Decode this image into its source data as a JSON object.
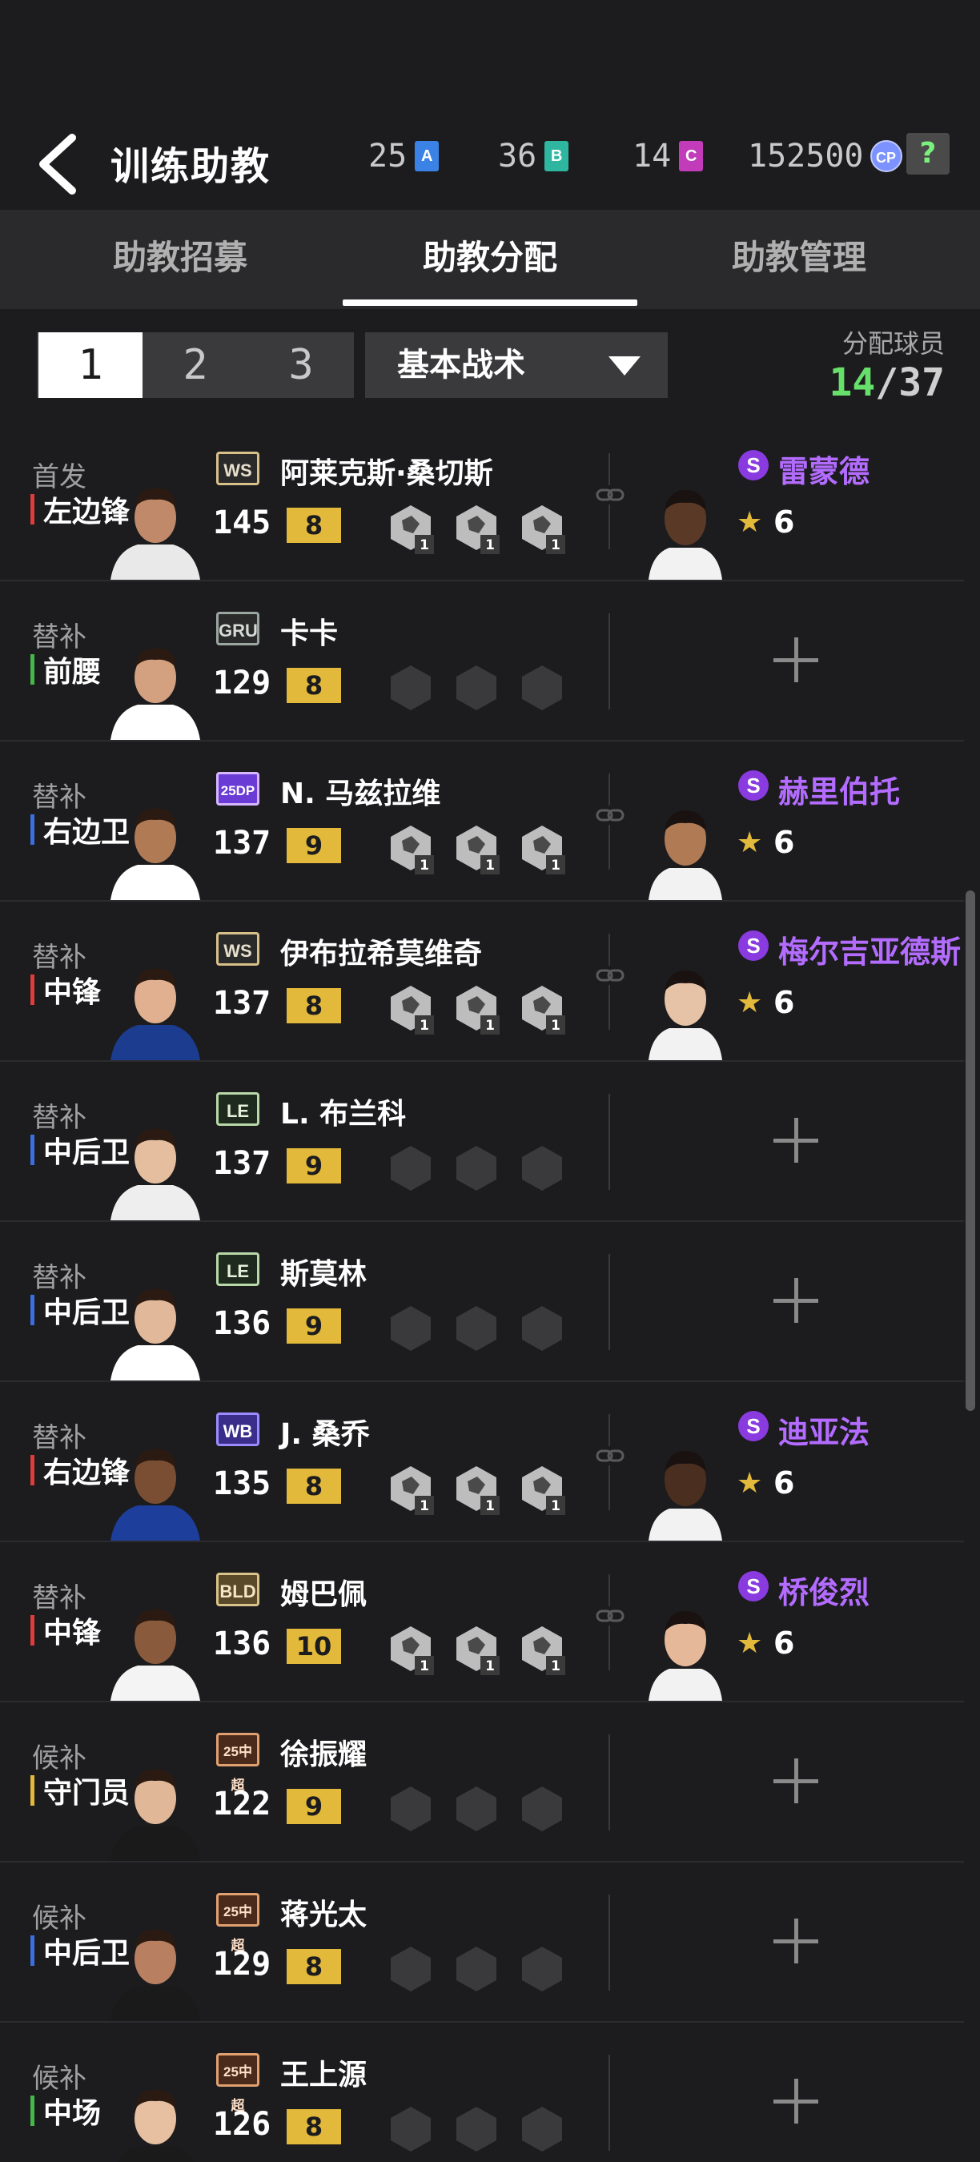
{
  "header": {
    "title": "训练助教",
    "currencies": [
      {
        "amount": "25",
        "badge": "A",
        "color": "#3b82e6"
      },
      {
        "amount": "36",
        "badge": "B",
        "color": "#2fb6a0"
      },
      {
        "amount": "14",
        "badge": "C",
        "color": "#c23bb8"
      }
    ],
    "cp_amount": "152500",
    "cp_label": "CP",
    "help_label": "?"
  },
  "tabs": [
    {
      "label": "助教招募",
      "active": false
    },
    {
      "label": "助教分配",
      "active": true
    },
    {
      "label": "助教管理",
      "active": false
    }
  ],
  "pages": [
    "1",
    "2",
    "3"
  ],
  "selected_page": "1",
  "dropdown": {
    "label": "基本战术"
  },
  "allocation": {
    "label": "分配球员",
    "current": "14",
    "total": "/37"
  },
  "colors": {
    "forward": "#e03c3c",
    "mid": "#45b84a",
    "defense": "#3b6fe0",
    "keeper": "#e2b93b",
    "level": "#e2b93b",
    "coach_name": "#b36cff"
  },
  "players": [
    {
      "status": "首发",
      "position": "左边锋",
      "pos_color": "#e03c3c",
      "tag": "WS",
      "name": "阿莱克斯·桑切斯",
      "ovr": "145",
      "level": "8",
      "skills": [
        "1",
        "1",
        "1"
      ],
      "coach": {
        "name": "雷蒙德",
        "rating": "6",
        "badge": "S"
      }
    },
    {
      "status": "替补",
      "position": "前腰",
      "pos_color": "#45b84a",
      "tag": "GRU",
      "name": "卡卡",
      "ovr": "129",
      "level": "8",
      "skills": [],
      "coach": null
    },
    {
      "status": "替补",
      "position": "右边卫",
      "pos_color": "#3b6fe0",
      "tag": "25DP",
      "name": "N. 马兹拉维",
      "ovr": "137",
      "level": "9",
      "skills": [
        "1",
        "1",
        "1"
      ],
      "coach": {
        "name": "赫里伯托",
        "rating": "6",
        "badge": "S"
      }
    },
    {
      "status": "替补",
      "position": "中锋",
      "pos_color": "#e03c3c",
      "tag": "WS",
      "name": "伊布拉希莫维奇",
      "ovr": "137",
      "level": "8",
      "skills": [
        "1",
        "1",
        "1"
      ],
      "coach": {
        "name": "梅尔吉亚德斯",
        "rating": "6",
        "badge": "S"
      }
    },
    {
      "status": "替补",
      "position": "中后卫",
      "pos_color": "#3b6fe0",
      "tag": "LE",
      "name": "L. 布兰科",
      "ovr": "137",
      "level": "9",
      "skills": [],
      "coach": null
    },
    {
      "status": "替补",
      "position": "中后卫",
      "pos_color": "#3b6fe0",
      "tag": "LE",
      "name": "斯莫林",
      "ovr": "136",
      "level": "9",
      "skills": [],
      "coach": null
    },
    {
      "status": "替补",
      "position": "右边锋",
      "pos_color": "#e03c3c",
      "tag": "WB",
      "name": "J. 桑乔",
      "ovr": "135",
      "level": "8",
      "skills": [
        "1",
        "1",
        "1"
      ],
      "coach": {
        "name": "迪亚法",
        "rating": "6",
        "badge": "S"
      }
    },
    {
      "status": "替补",
      "position": "中锋",
      "pos_color": "#e03c3c",
      "tag": "BLD",
      "name": "姆巴佩",
      "ovr": "136",
      "level": "10",
      "skills": [
        "1",
        "1",
        "1"
      ],
      "coach": {
        "name": "桥俊烈",
        "rating": "6",
        "badge": "S"
      }
    },
    {
      "status": "候补",
      "position": "守门员",
      "pos_color": "#e2b93b",
      "tag": "25中超",
      "name": "徐振耀",
      "ovr": "122",
      "level": "9",
      "skills": [],
      "coach": null
    },
    {
      "status": "候补",
      "position": "中后卫",
      "pos_color": "#3b6fe0",
      "tag": "25中超",
      "name": "蒋光太",
      "ovr": "129",
      "level": "8",
      "skills": [],
      "coach": null
    },
    {
      "status": "候补",
      "position": "中场",
      "pos_color": "#45b84a",
      "tag": "25中超",
      "name": "王上源",
      "ovr": "126",
      "level": "8",
      "skills": [],
      "coach": null
    }
  ]
}
